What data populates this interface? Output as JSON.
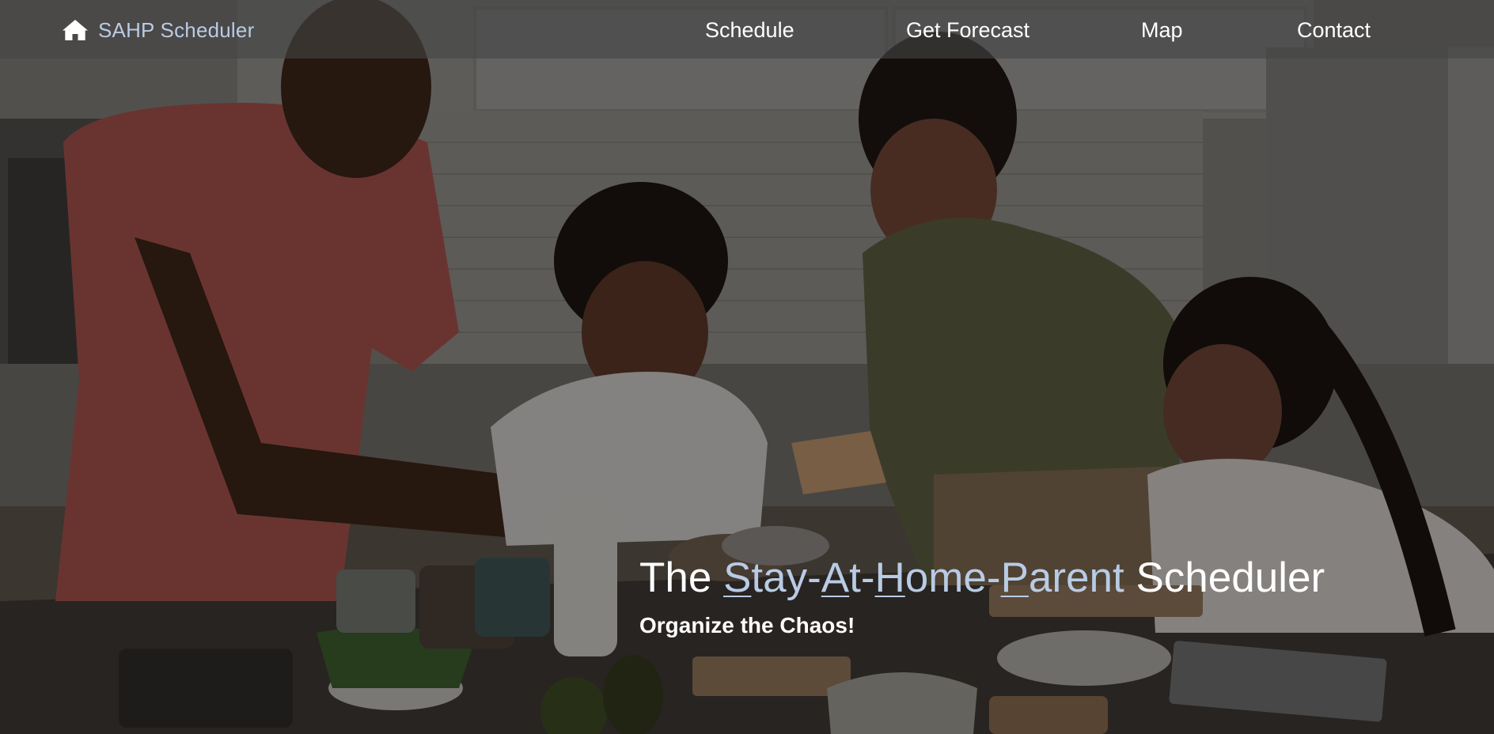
{
  "navbar": {
    "brand_icon": "home-icon",
    "brand_label": "SAHP Scheduler",
    "links": {
      "schedule": "Schedule",
      "forecast": "Get Forecast",
      "map": "Map",
      "contact": "Contact"
    }
  },
  "hero": {
    "title_prefix": "The ",
    "title_accent_parts": [
      "S",
      "tay-",
      "A",
      "t-",
      "H",
      "ome-",
      "P",
      "arent"
    ],
    "title_suffix": " Scheduler",
    "subtitle": "Organize the Chaos!"
  },
  "colors": {
    "accent": "#b9cbe4",
    "text": "#ffffff",
    "navbar_bg": "rgba(70,70,70,0.62)"
  }
}
